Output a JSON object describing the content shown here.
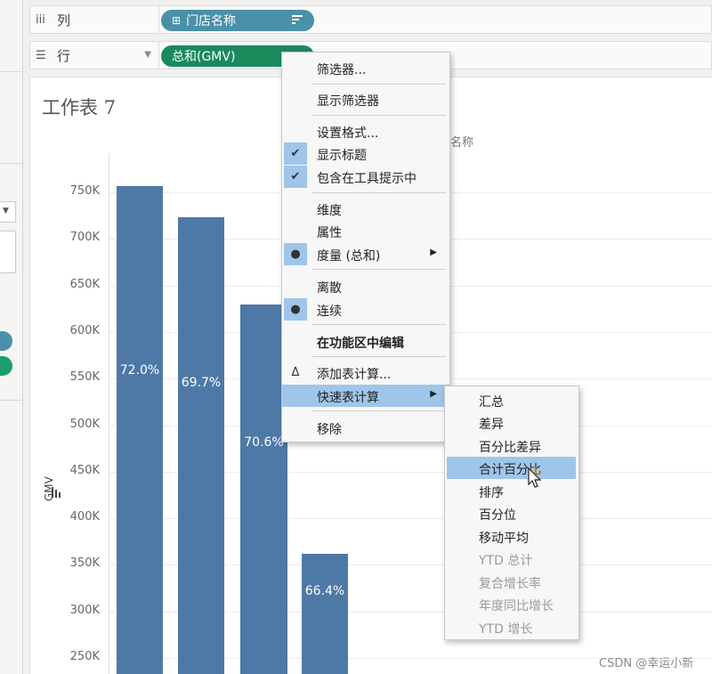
{
  "shelves": {
    "columns": {
      "icon": "iii",
      "label": "列",
      "pill": {
        "icon": "⊞",
        "label": "门店名称"
      }
    },
    "rows": {
      "icon": "☰",
      "label": "行",
      "pill": {
        "label": "总和(GMV)"
      }
    }
  },
  "worksheet": {
    "title": "工作表 7",
    "column_header": "名称"
  },
  "chart_data": {
    "type": "bar",
    "ylabel": "GMV",
    "y_ticks": [
      "750K",
      "700K",
      "650K",
      "600K",
      "550K",
      "500K",
      "450K",
      "400K",
      "350K",
      "300K",
      "250K"
    ],
    "series": [
      {
        "values": [
          757000,
          723000,
          630000,
          362000
        ]
      }
    ],
    "data_labels": [
      "72.0%",
      "69.7%",
      "70.6%",
      "66.4%"
    ],
    "color": "#4e79a7"
  },
  "context_menu": {
    "items": [
      {
        "label": "筛选器..."
      },
      {
        "label": "显示筛选器"
      },
      {
        "label": "设置格式..."
      },
      {
        "label": "显示标题",
        "mark": "✔"
      },
      {
        "label": "包含在工具提示中",
        "mark": "✔"
      },
      {
        "label": "维度"
      },
      {
        "label": "属性"
      },
      {
        "label": "度量 (总和)",
        "mark": "●"
      },
      {
        "label": "离散"
      },
      {
        "label": "连续",
        "mark": "●"
      },
      {
        "label": "在功能区中编辑"
      },
      {
        "label": "添加表计算...",
        "mark": "Δ"
      },
      {
        "label": "快速表计算"
      },
      {
        "label": "移除"
      }
    ]
  },
  "quick_table_calc_submenu": {
    "items": [
      {
        "label": "汇总"
      },
      {
        "label": "差异"
      },
      {
        "label": "百分比差异"
      },
      {
        "label": "合计百分比"
      },
      {
        "label": "排序"
      },
      {
        "label": "百分位"
      },
      {
        "label": "移动平均"
      },
      {
        "label": "YTD 总计"
      },
      {
        "label": "复合增长率"
      },
      {
        "label": "年度同比增长"
      },
      {
        "label": "YTD 增长"
      }
    ]
  },
  "watermark": "CSDN @幸运小新",
  "colors": {
    "dimension_pill": "#4a90a8",
    "measure_pill": "#1a8a5c",
    "menu_highlight": "#9fc5ea",
    "bar": "#4e79a7"
  }
}
